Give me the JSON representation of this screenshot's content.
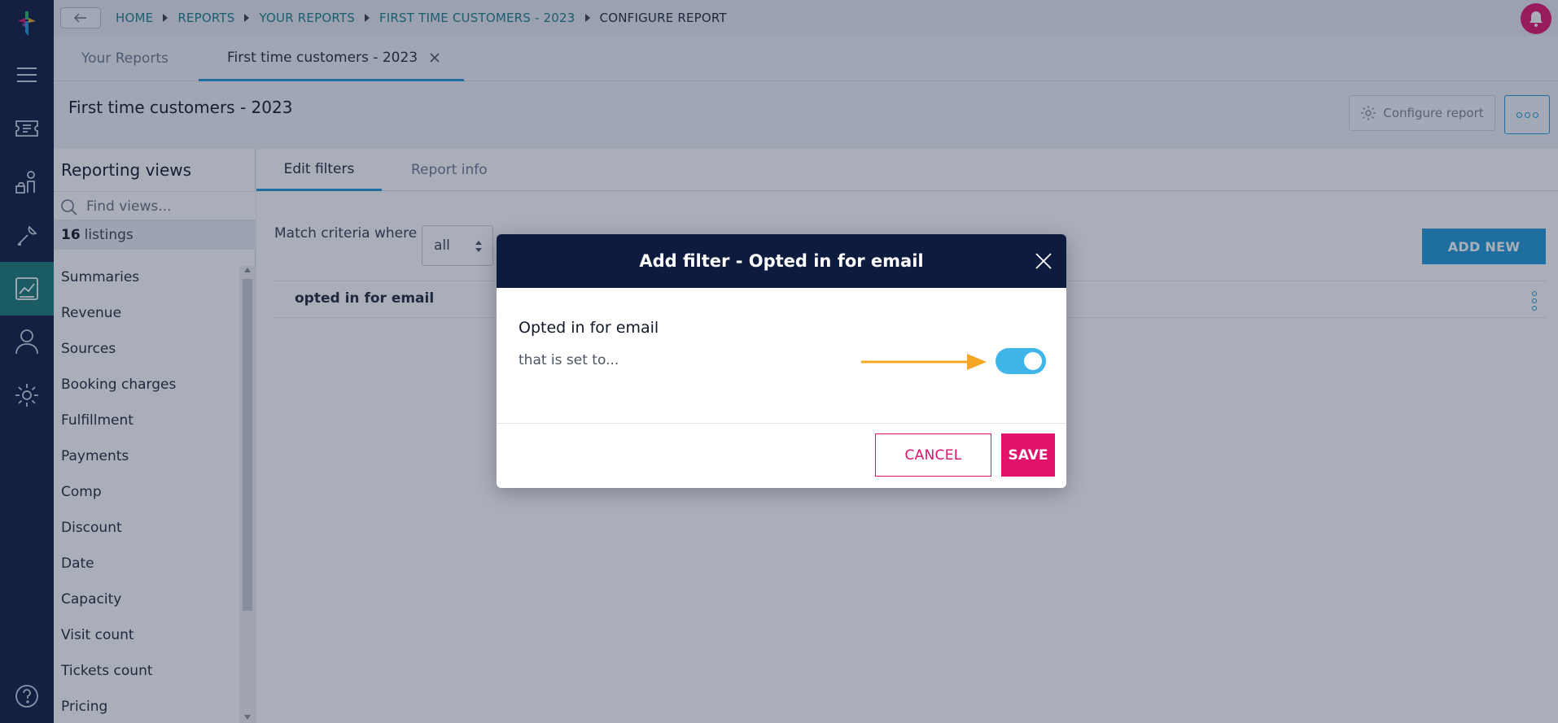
{
  "breadcrumb": {
    "items": [
      "HOME",
      "REPORTS",
      "YOUR REPORTS",
      "FIRST TIME CUSTOMERS - 2023",
      "CONFIGURE REPORT"
    ]
  },
  "tabs": [
    {
      "label": "Your Reports"
    },
    {
      "label": "First time customers - 2023"
    }
  ],
  "header": {
    "title": "First time customers - 2023",
    "configure_label": "Configure report"
  },
  "views": {
    "title": "Reporting views",
    "search_placeholder": "Find views...",
    "count": "16",
    "count_label": "listings",
    "items": [
      "Summaries",
      "Revenue",
      "Sources",
      "Booking charges",
      "Fulfillment",
      "Payments",
      "Comp",
      "Discount",
      "Date",
      "Capacity",
      "Visit count",
      "Tickets count",
      "Pricing"
    ]
  },
  "subtabs": [
    {
      "label": "Edit filters"
    },
    {
      "label": "Report info"
    }
  ],
  "filters": {
    "match_label": "Match criteria where",
    "match_value": "all",
    "add_new_label": "ADD NEW",
    "rows": [
      {
        "label": "opted in for email"
      }
    ]
  },
  "modal": {
    "title": "Add filter - Opted in for email",
    "field_title": "Opted in for email",
    "field_sub": "that is set to...",
    "toggle_on": true,
    "cancel_label": "CANCEL",
    "save_label": "SAVE"
  },
  "colors": {
    "rail": "#0d1b3e",
    "accent_blue": "#1f9ad6",
    "brand_pink": "#e2126b",
    "toggle": "#3fb5ea",
    "annotation": "#f5a623"
  }
}
